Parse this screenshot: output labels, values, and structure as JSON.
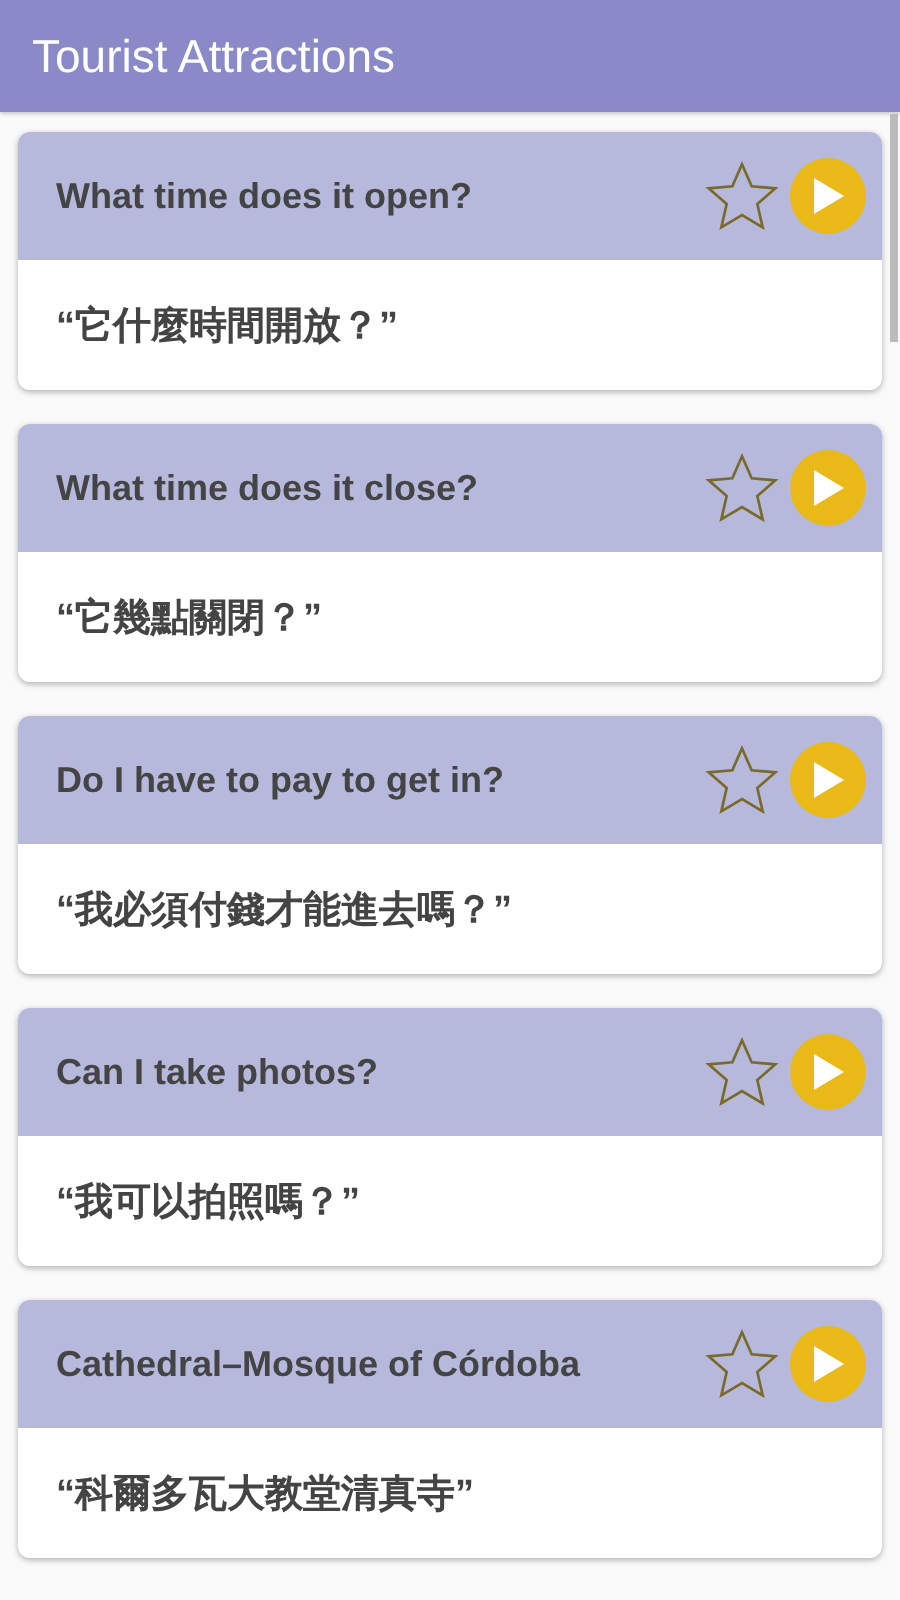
{
  "app_bar": {
    "title": "Tourist Attractions"
  },
  "phrases": [
    {
      "english": "What time does it open?",
      "translation": "“它什麼時間開放？”",
      "starred": false
    },
    {
      "english": "What time does it close?",
      "translation": "“它幾點關閉？”",
      "starred": false
    },
    {
      "english": "Do I have to pay to get in?",
      "translation": "“我必須付錢才能進去嗎？”",
      "starred": false
    },
    {
      "english": "Can I take photos?",
      "translation": "“我可以拍照嗎？”",
      "starred": false
    },
    {
      "english": "Cathedral–Mosque of Córdoba",
      "translation": "“科爾多瓦大教堂清真寺”",
      "starred": false
    }
  ]
}
